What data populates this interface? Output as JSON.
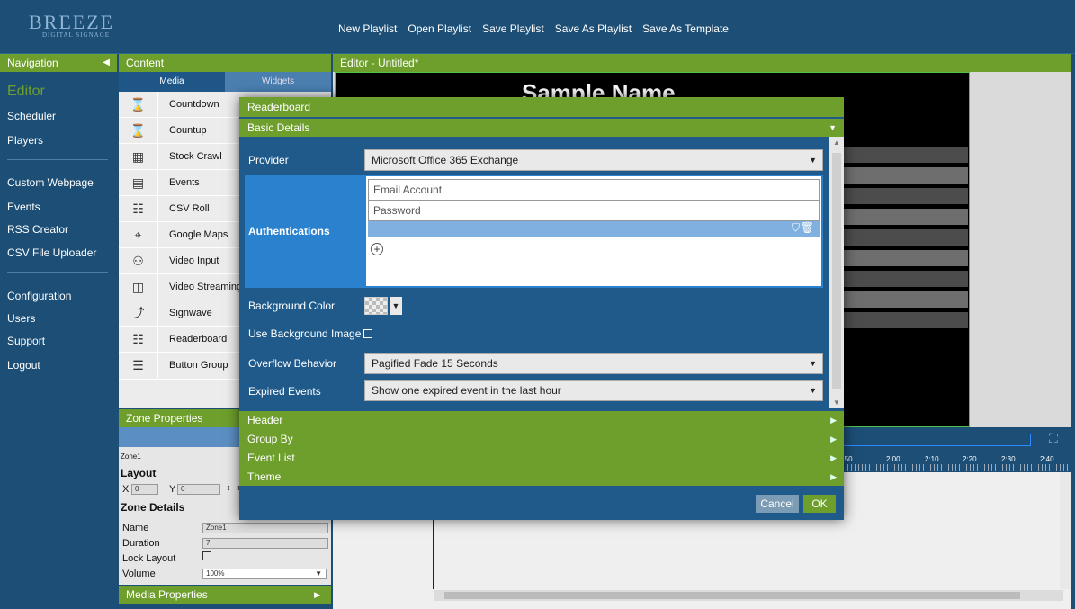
{
  "brand": {
    "logo_main": "BREEZE",
    "logo_sub": "DIGITAL SIGNAGE"
  },
  "topmenu": [
    "New Playlist",
    "Open Playlist",
    "Save Playlist",
    "Save As Playlist",
    "Save As Template"
  ],
  "navigation": {
    "title": "Navigation",
    "items": [
      "Editor",
      "Scheduler",
      "Players",
      "Custom Webpage",
      "Events",
      "RSS Creator",
      "CSV File Uploader",
      "Configuration",
      "Users",
      "Support",
      "Logout"
    ]
  },
  "content": {
    "title": "Content",
    "tabs": [
      "Media",
      "Widgets"
    ],
    "widgets": [
      "Countdown",
      "Countup",
      "Stock Crawl",
      "Events",
      "CSV Roll",
      "Google Maps",
      "Video Input",
      "Video Streaming",
      "Signwave",
      "Readerboard",
      "Button Group"
    ]
  },
  "zone_properties": {
    "title": "Zone Properties",
    "zone_name": "Zone1",
    "layout_label": "Layout",
    "x_label": "X",
    "x_value": "0",
    "y_label": "Y",
    "y_value": "0",
    "details_label": "Zone Details",
    "name_label": "Name",
    "name_value": "Zone1",
    "duration_label": "Duration",
    "duration_value": "7",
    "lock_label": "Lock Layout",
    "volume_label": "Volume",
    "volume_value": "100%"
  },
  "media_properties": {
    "title": "Media Properties"
  },
  "editor": {
    "title": "Editor - Untitled*",
    "sample_text": "Sample Name"
  },
  "timeline": {
    "ticks": [
      "1:50",
      "2:00",
      "2:10",
      "2:20",
      "2:30",
      "2:40"
    ]
  },
  "dialog": {
    "title": "Readerboard",
    "section": "Basic Details",
    "provider_label": "Provider",
    "provider_value": "Microsoft Office 365 Exchange",
    "auth_label": "Authentications",
    "email_placeholder": "Email Account",
    "password_placeholder": "Password",
    "bgcolor_label": "Background Color",
    "bgimage_label": "Use Background Image",
    "overflow_label": "Overflow Behavior",
    "overflow_value": "Pagified Fade 15 Seconds",
    "expired_label": "Expired Events",
    "expired_value": "Show one expired event in the last hour",
    "sections": [
      "Header",
      "Group By",
      "Event List",
      "Theme"
    ],
    "cancel": "Cancel",
    "ok": "OK"
  },
  "colors": {
    "accent_green": "#6e9f2c",
    "navy": "#1c4e76",
    "dialog_blue": "#1f5a8a",
    "auth_blue": "#2a82cf"
  }
}
